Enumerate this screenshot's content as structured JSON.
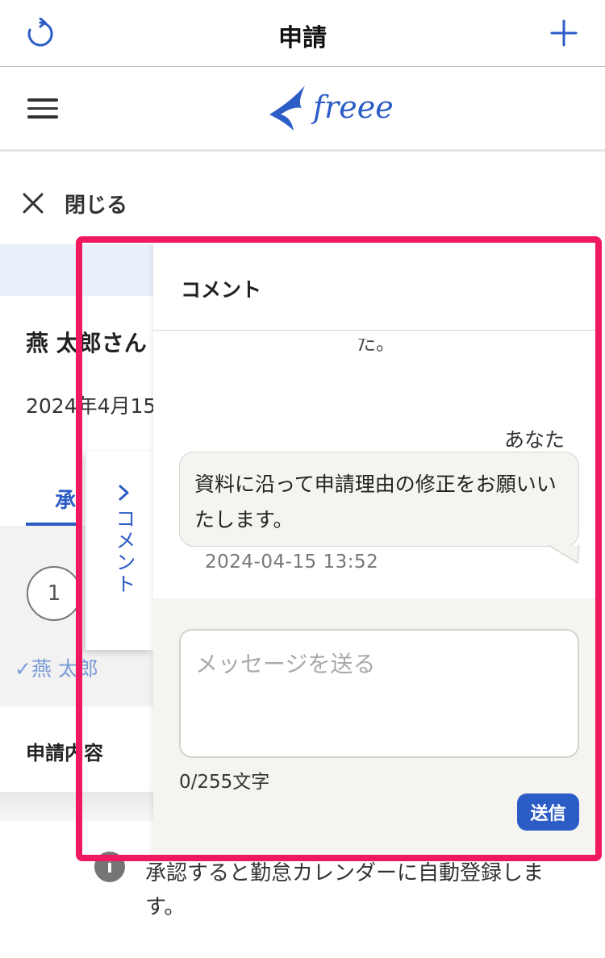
{
  "nav": {
    "title": "申請",
    "refresh_icon": "refresh-icon",
    "add_icon": "plus-icon",
    "accent": "#2c5cc5"
  },
  "header": {
    "logo_text": "freee",
    "menu_icon": "hamburger-menu-icon"
  },
  "close": {
    "label": "閉じる"
  },
  "background": {
    "user_name": "燕 太郎さん",
    "date": "2024年4月15",
    "tab_label": "承",
    "step_number": "1",
    "approver": "✓燕 太郎",
    "section_title": "申請内容",
    "info_text": "承認すると勤怠カレンダーに自動登録します。"
  },
  "comment_tab": {
    "label": "コメント"
  },
  "comment_panel": {
    "title": "コメント",
    "cut_text": "た。",
    "message": {
      "sender": "あなた",
      "text": "資料に沿って申請理由の修正をお願いいたします。",
      "timestamp": "2024-04-15 13:52"
    },
    "input": {
      "placeholder": "メッセージを送る",
      "value": ""
    },
    "counter": "0/255文字",
    "send_label": "送信"
  },
  "highlight_color": "#f0185f"
}
